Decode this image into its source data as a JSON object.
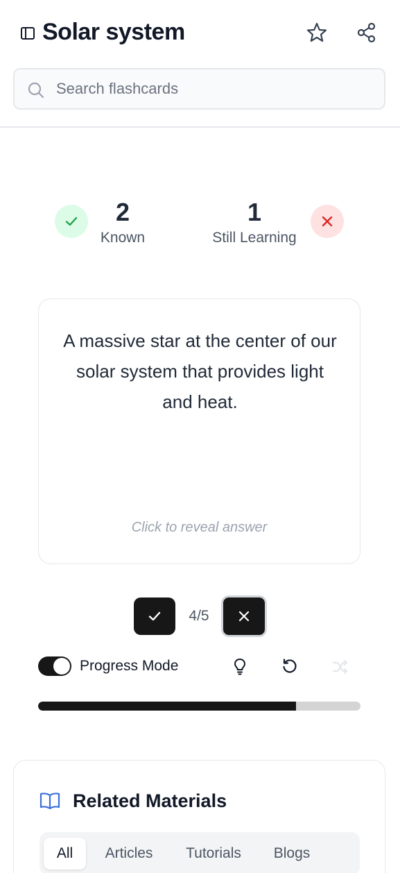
{
  "header": {
    "title": "Solar system",
    "sidebar_icon": "sidebar-toggle-icon",
    "star_icon": "star-icon",
    "share_icon": "share-icon"
  },
  "search": {
    "placeholder": "Search flashcards",
    "value": ""
  },
  "stats": {
    "known_count": "2",
    "known_label": "Known",
    "learning_count": "1",
    "learning_label": "Still Learning"
  },
  "card": {
    "front_text": "A massive star at the center of our solar system that provides light and heat.",
    "hint": "Click to reveal answer"
  },
  "controls": {
    "counter": "4/5",
    "progress_mode_label": "Progress Mode",
    "progress_mode_on": true,
    "progress_fraction": 0.8
  },
  "related": {
    "title": "Related Materials",
    "tabs": [
      "All",
      "Articles",
      "Tutorials",
      "Blogs"
    ],
    "active_tab": "All"
  },
  "colors": {
    "accent_dark": "#171717",
    "known_bg": "#dcfce7",
    "known_fg": "#22a34a",
    "learning_bg": "#fee2e2",
    "learning_fg": "#dc2626",
    "link_blue": "#3b6fd8"
  }
}
